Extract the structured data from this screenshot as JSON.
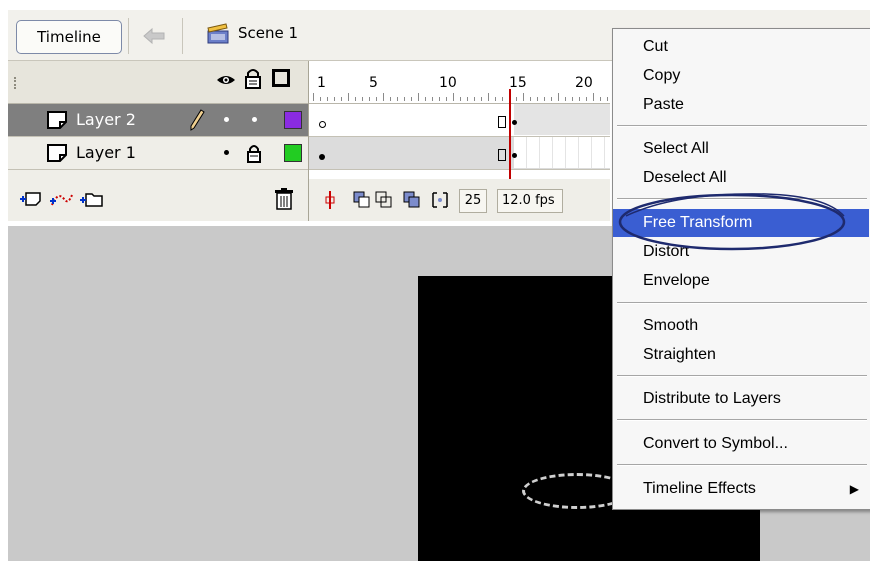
{
  "toolbar": {
    "timeline_label": "Timeline",
    "scene_label": "Scene 1"
  },
  "timeline": {
    "ruler_numbers": [
      "1",
      "5",
      "10",
      "15",
      "20"
    ],
    "layers": [
      {
        "name": "Layer 2",
        "selected": true,
        "color": "#8a2be2"
      },
      {
        "name": "Layer 1",
        "selected": false,
        "color": "#22cc22"
      }
    ],
    "status": {
      "current_frame": "25",
      "frame_rate": "12.0 fps"
    }
  },
  "context_menu": {
    "items": [
      {
        "label": "Cut"
      },
      {
        "label": "Copy"
      },
      {
        "label": "Paste"
      },
      {
        "label": "Select All"
      },
      {
        "label": "Deselect All"
      },
      {
        "label": "Free Transform",
        "highlighted": true
      },
      {
        "label": "Distort"
      },
      {
        "label": "Envelope"
      },
      {
        "label": "Smooth"
      },
      {
        "label": "Straighten"
      },
      {
        "label": "Distribute to Layers"
      },
      {
        "label": "Convert to Symbol..."
      },
      {
        "label": "Timeline Effects",
        "has_submenu": true
      }
    ]
  },
  "colors": {
    "menu_highlight": "#3a5ed2",
    "annotation_circle": "#1e2a6e",
    "stage_bg": "#c9c9c9",
    "canvas_bg": "#000000"
  }
}
